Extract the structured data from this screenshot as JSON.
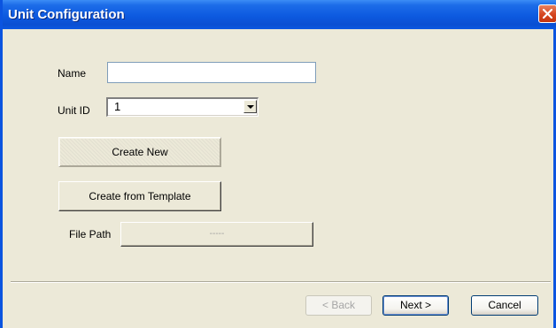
{
  "window": {
    "title": "Unit Configuration"
  },
  "form": {
    "name_label": "Name",
    "name_value": "",
    "unit_id_label": "Unit ID",
    "unit_id_value": "1",
    "create_new_label": "Create New",
    "create_from_template_label": "Create from Template",
    "file_path_label": "File Path",
    "file_path_value": "-----"
  },
  "footer": {
    "back_label": "< Back",
    "next_label": "Next >",
    "cancel_label": "Cancel"
  },
  "icons": {
    "close": "close-icon",
    "dropdown": "chevron-down-icon"
  },
  "colors": {
    "titlebar": "#0a4fd2",
    "close_button": "#d5451f",
    "dialog_background": "#ece9d8"
  }
}
